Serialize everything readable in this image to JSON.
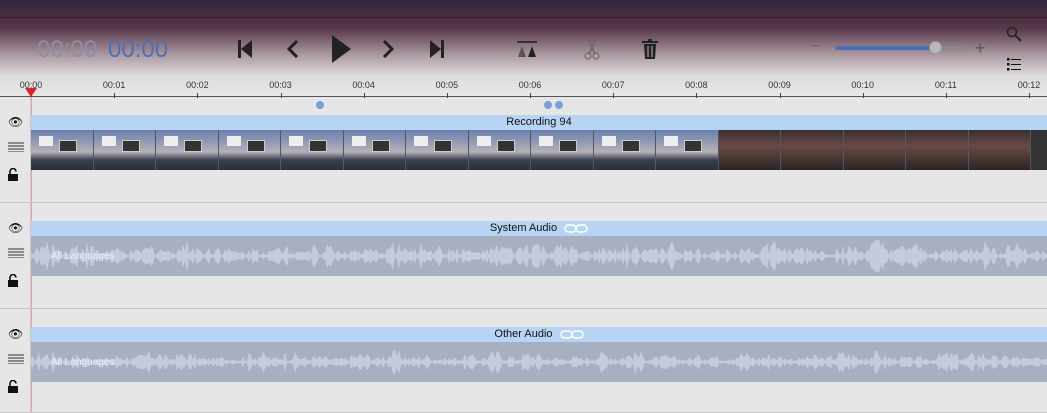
{
  "transport": {
    "timecode_dim": "00:00",
    "timecode": "00:00"
  },
  "icons": [
    "skip-back-icon",
    "step-back-icon",
    "play-icon",
    "step-forward-icon",
    "skip-forward-icon",
    "split-icon",
    "scissors-icon",
    "trash-icon",
    "zoom-out-icon",
    "zoom-in-icon",
    "search-icon",
    "list-icon"
  ],
  "zoom": {
    "level": 0.78,
    "minus": "−",
    "plus": "+"
  },
  "ruler": {
    "ticks": [
      "00:00",
      "00:01",
      "00:02",
      "00:03",
      "00:04",
      "00:05",
      "00:06",
      "00:07",
      "00:08",
      "00:09",
      "00:10",
      "00:11",
      "00:12"
    ]
  },
  "markers_seconds": [
    3.48,
    6.22,
    6.35
  ],
  "tracks": [
    {
      "title": "Recording 94",
      "type": "video"
    },
    {
      "title": "System Audio",
      "type": "audio",
      "label": "All Languages",
      "linked": true
    },
    {
      "title": "Other Audio",
      "type": "audio",
      "label": "All Languages",
      "linked": true
    }
  ],
  "colors": {
    "accent": "#4d6fb3",
    "header": "#b8d4f5",
    "playhead": "#e0202a",
    "marker": "#7b9ee0"
  }
}
